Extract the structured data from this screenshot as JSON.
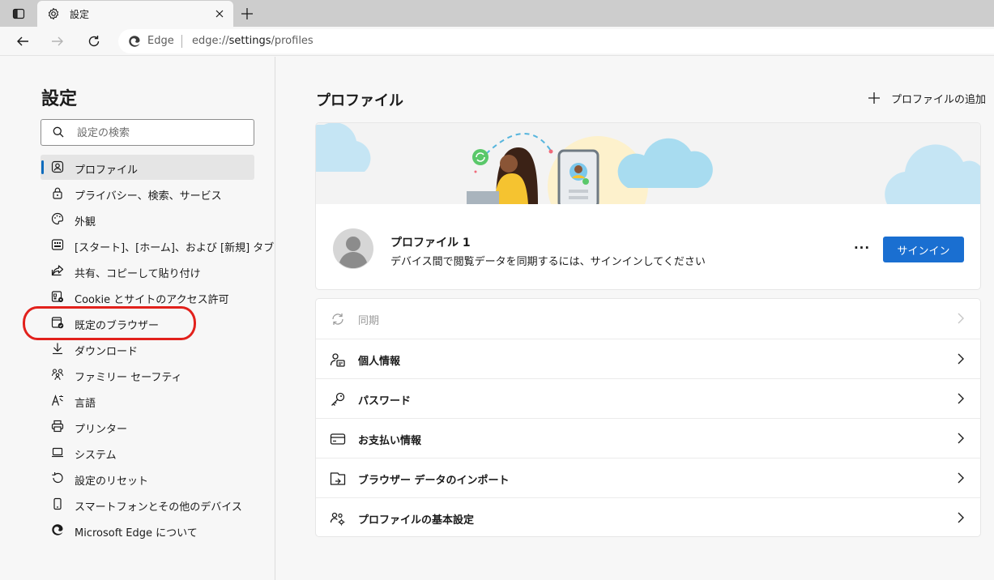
{
  "browser": {
    "tab_title": "設定",
    "address_site": "Edge",
    "address_url_prefix": "edge://",
    "address_url_main": "settings",
    "address_url_suffix": "/profiles"
  },
  "sidebar": {
    "title": "設定",
    "search_placeholder": "設定の検索",
    "items": [
      {
        "label": "プロファイル",
        "icon": "profile-icon"
      },
      {
        "label": "プライバシー、検索、サービス",
        "icon": "lock-icon"
      },
      {
        "label": "外観",
        "icon": "palette-icon"
      },
      {
        "label": "[スタート]、[ホーム]、および [新規] タブ",
        "icon": "start-page-icon"
      },
      {
        "label": "共有、コピーして貼り付け",
        "icon": "share-icon"
      },
      {
        "label": "Cookie とサイトのアクセス許可",
        "icon": "site-permissions-icon"
      },
      {
        "label": "既定のブラウザー",
        "icon": "default-browser-icon"
      },
      {
        "label": "ダウンロード",
        "icon": "download-icon"
      },
      {
        "label": "ファミリー セーフティ",
        "icon": "family-icon"
      },
      {
        "label": "言語",
        "icon": "language-icon"
      },
      {
        "label": "プリンター",
        "icon": "printer-icon"
      },
      {
        "label": "システム",
        "icon": "laptop-icon"
      },
      {
        "label": "設定のリセット",
        "icon": "reset-icon"
      },
      {
        "label": "スマートフォンとその他のデバイス",
        "icon": "phone-icon"
      },
      {
        "label": "Microsoft Edge について",
        "icon": "edge-logo-icon"
      }
    ]
  },
  "main": {
    "title": "プロファイル",
    "add_profile": "プロファイルの追加",
    "profile": {
      "name": "プロファイル 1",
      "description": "デバイス間で閲覧データを同期するには、サインインしてください",
      "signin": "サインイン",
      "more": "···"
    },
    "rows": [
      {
        "label": "同期",
        "icon": "sync-icon"
      },
      {
        "label": "個人情報",
        "icon": "personal-info-icon"
      },
      {
        "label": "パスワード",
        "icon": "key-icon"
      },
      {
        "label": "お支払い情報",
        "icon": "credit-card-icon"
      },
      {
        "label": "ブラウザー データのインポート",
        "icon": "import-icon"
      },
      {
        "label": "プロファイルの基本設定",
        "icon": "profile-settings-icon"
      }
    ]
  },
  "colors": {
    "accent": "#1a6fd1",
    "highlight": "#e2211c"
  }
}
